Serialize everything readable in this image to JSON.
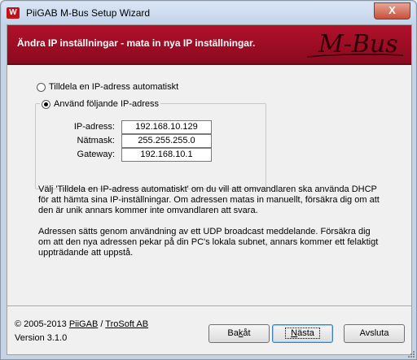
{
  "window": {
    "title": "PiiGAB M-Bus Setup Wizard",
    "close_glyph": "X",
    "icon_letter": "W"
  },
  "banner": {
    "heading": "Ändra IP inställningar - mata in nya IP inställningar.",
    "logo_text": "M-Bus",
    "color": "#a00d25"
  },
  "options": {
    "auto_label": "Tilldela en IP-adress automatiskt",
    "manual_label": "Använd följande IP-adress",
    "selected": "manual"
  },
  "fields": {
    "ip_label": "IP-adress:",
    "ip_value": "192.168.10.129",
    "mask_label": "Nätmask:",
    "mask_value": "255.255.255.0",
    "gateway_label": "Gateway:",
    "gateway_value": "192.168.10.1"
  },
  "description": {
    "para1": "Välj 'Tilldela en IP-adress automatiskt' om du vill att omvandlaren ska använda DHCP för att hämta sina IP-inställningar. Om adressen matas in manuellt, försäkra dig om att den är unik annars kommer inte omvandlaren att svara.",
    "para2": "Adressen sätts genom användning av ett UDP broadcast meddelande. Försäkra dig om att den nya adressen pekar på din PC's lokala subnet, annars kommer ett felaktigt uppträdande att uppstå."
  },
  "footer": {
    "copyright": "© 2005-2013",
    "link1": "PiiGAB",
    "separator": "/",
    "link2": "TroSoft AB",
    "version": "Version 3.1.0"
  },
  "buttons": {
    "back": "Bakåt",
    "next": "Nästa",
    "cancel": "Avsluta"
  }
}
